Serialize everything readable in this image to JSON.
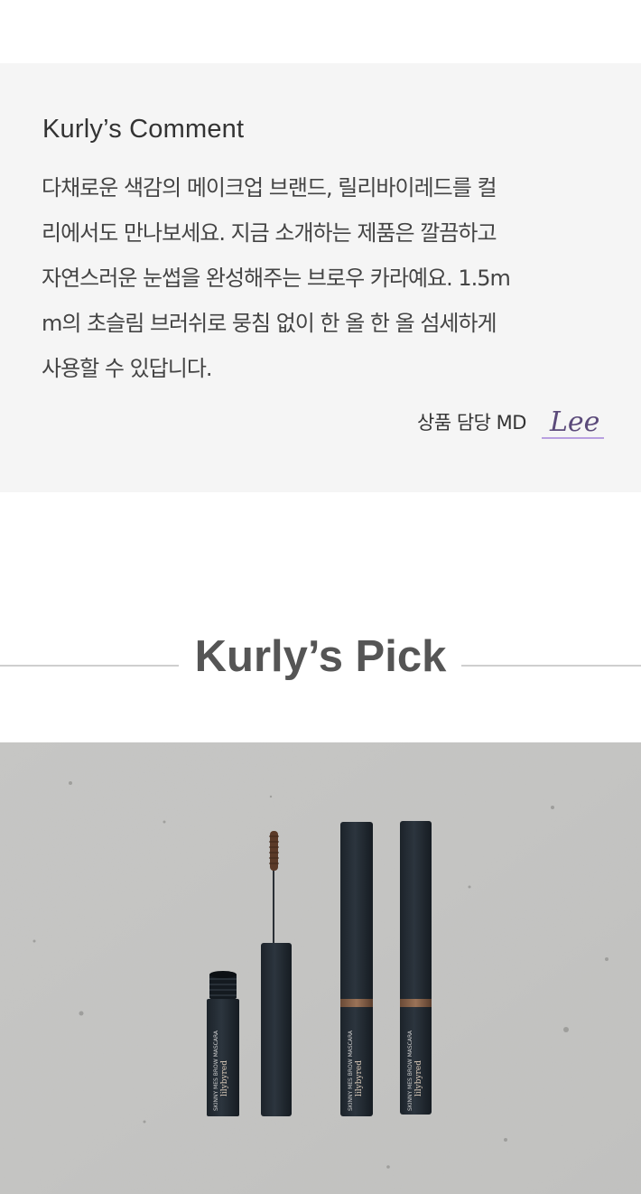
{
  "comment": {
    "title": "Kurly’s Comment",
    "body_lines": [
      "다채로운 색감의 메이크업 브랜드, 릴리바이레드를 컬",
      "리에서도 만나보세요. 지금 소개하는 제품은 깔끔하고",
      "자연스러운 눈썹을 완성해주는 브로우 카라예요. 1.5m",
      "m의 초슬림 브러쉬로 뭉침 없이 한 올 한 올 섬세하게",
      "사용할 수 있답니다."
    ],
    "md_label": "상품 담당 MD",
    "signature": "Lee"
  },
  "pick": {
    "title": "Kurly’s Pick"
  },
  "product_photo": {
    "brand": "lilybyred",
    "product_name": "SKINNY MES BROW MASCARA"
  },
  "colors": {
    "box_bg": "#f5f5f5",
    "signature_underline": "#b9a0e0",
    "signature_ink": "#5b4a7a"
  }
}
